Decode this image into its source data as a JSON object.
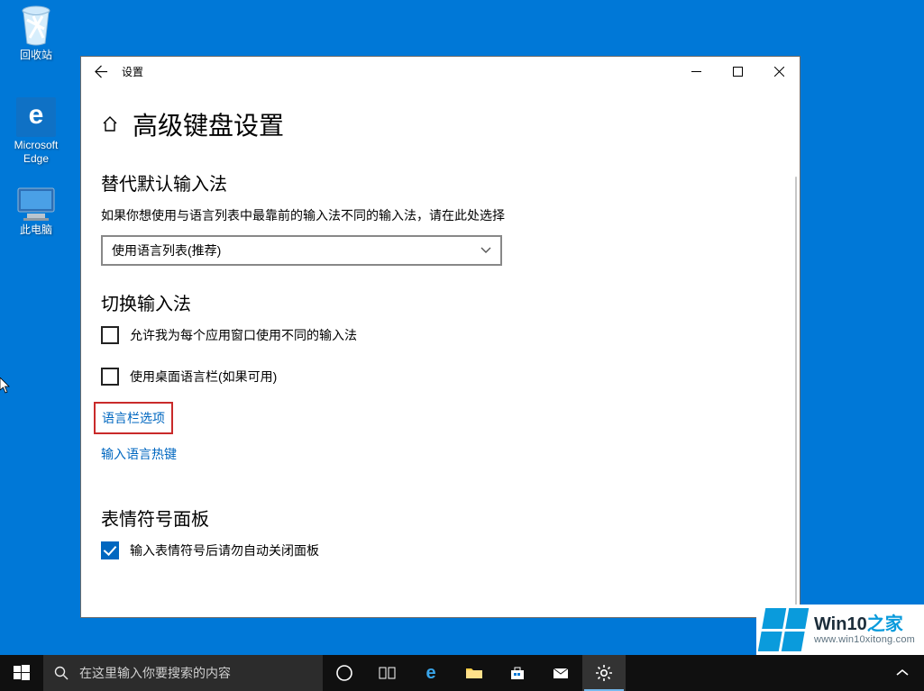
{
  "desktop": {
    "icons": [
      {
        "label": "回收站"
      },
      {
        "label": "Microsoft Edge"
      },
      {
        "label": "此电脑"
      }
    ]
  },
  "window": {
    "app_name": "设置",
    "page_title": "高级键盘设置"
  },
  "sections": {
    "override": {
      "heading": "替代默认输入法",
      "desc": "如果你想使用与语言列表中最靠前的输入法不同的输入法，请在此处选择",
      "combo_value": "使用语言列表(推荐)"
    },
    "switch_ime": {
      "heading": "切换输入法",
      "chk1": "允许我为每个应用窗口使用不同的输入法",
      "chk2": "使用桌面语言栏(如果可用)",
      "link1": "语言栏选项",
      "link2": "输入语言热键"
    },
    "emoji": {
      "heading": "表情符号面板",
      "chk": "输入表情符号后请勿自动关闭面板"
    }
  },
  "taskbar": {
    "search_placeholder": "在这里输入你要搜索的内容"
  },
  "watermark": {
    "brand_main": "Win10",
    "brand_suffix": "之家",
    "url": "www.win10xitong.com"
  }
}
